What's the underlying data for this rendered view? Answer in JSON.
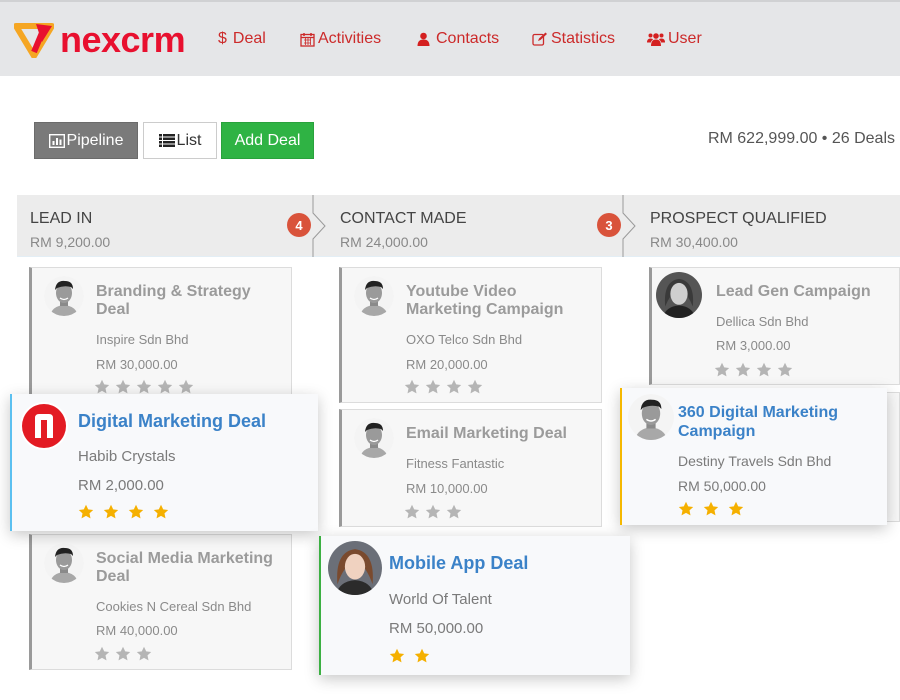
{
  "brand": {
    "name": "nexcrm",
    "color": "#e8102f",
    "accent": "#f5a623"
  },
  "nav": [
    {
      "label": "Deal",
      "icon": "dollar-icon"
    },
    {
      "label": "Activities",
      "icon": "calendar-icon"
    },
    {
      "label": "Contacts",
      "icon": "user-icon"
    },
    {
      "label": "Statistics",
      "icon": "edit-icon"
    },
    {
      "label": "User",
      "icon": "users-icon"
    }
  ],
  "toolbar": {
    "pipeline_label": "Pipeline",
    "list_label": "List",
    "add_label": "Add Deal"
  },
  "summary": "RM 622,999.00 • 26 Deals",
  "stages": [
    {
      "name": "LEAD IN",
      "amount": "RM 9,200.00",
      "count": "4"
    },
    {
      "name": "CONTACT MADE",
      "amount": "RM 24,000.00",
      "count": "3"
    },
    {
      "name": "PROSPECT QUALIFIED",
      "amount": "RM 30,400.00",
      "count": ""
    }
  ],
  "cards": [
    {
      "title": "Branding & Strategy Deal",
      "company": "Inspire Sdn Bhd",
      "amount": "RM 30,000.00",
      "rating": 5,
      "avatar": "man"
    },
    {
      "title": "Social Media Marketing Deal",
      "company": "Cookies N Cereal Sdn Bhd",
      "amount": "RM 40,000.00",
      "rating": 3,
      "avatar": "man"
    },
    {
      "title": "Youtube Video Marketing Campaign",
      "company": "OXO Telco Sdn Bhd",
      "amount": "RM 20,000.00",
      "rating": 4,
      "avatar": "man"
    },
    {
      "title": "Email Marketing Deal",
      "company": "Fitness Fantastic",
      "amount": "RM 10,000.00",
      "rating": 3,
      "avatar": "man"
    },
    {
      "title": "Lead Gen Campaign",
      "company": "Dellica Sdn Bhd",
      "amount": "RM 3,000.00",
      "rating": 4,
      "avatar": "woman"
    }
  ],
  "popped_cards": [
    {
      "title": "Digital Marketing Deal",
      "company": "Habib Crystals",
      "amount": "RM 2,000.00",
      "rating": 4,
      "avatar": "logo-n",
      "accent": "#5bc0f0"
    },
    {
      "title": "360 Digital Marketing Campaign",
      "company": "Destiny Travels Sdn Bhd",
      "amount": "RM 50,000.00",
      "rating": 3,
      "avatar": "man",
      "accent": "#f5b800"
    },
    {
      "title": "Mobile App Deal",
      "company": "World Of Talent",
      "amount": "RM 50,000.00",
      "rating": 2,
      "avatar": "woman-color",
      "accent": "#3cb043"
    }
  ],
  "colors": {
    "star_active": "#f5b000",
    "star_inactive": "#b5b5b5",
    "badge": "#d9533b",
    "nav_text": "#cc2a2a"
  }
}
